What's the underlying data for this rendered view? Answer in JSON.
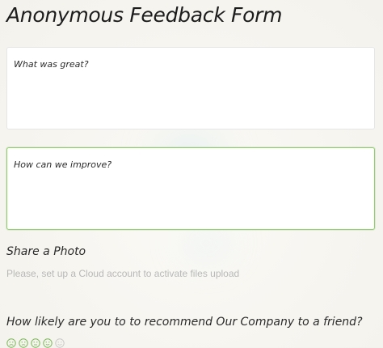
{
  "form": {
    "title": "Anonymous Feedback Form",
    "great_placeholder": "What was great?",
    "improve_placeholder": "How can we improve?",
    "share_photo_label": "Share a Photo",
    "upload_note": "Please, set up a Cloud account to activate files upload",
    "recommend_question": "How likely are you to to recommend Our Company to a friend?",
    "rating_icons": [
      "very-unhappy-face-icon",
      "unhappy-face-icon",
      "neutral-face-icon",
      "happy-face-icon",
      "very-happy-face-icon"
    ]
  },
  "colors": {
    "focus_border": "#8fcf6e",
    "placeholder_text": "#b8b8b8",
    "rating_icon": "#7cb85a"
  }
}
